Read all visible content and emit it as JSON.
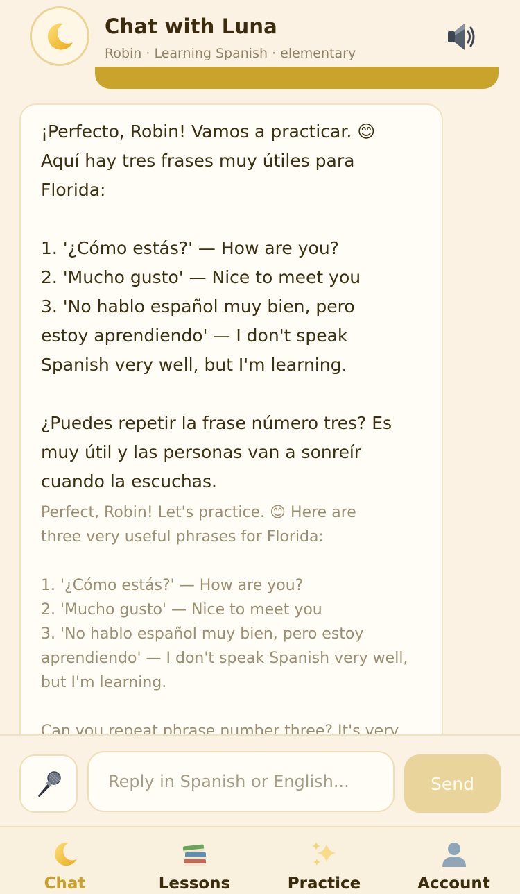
{
  "header": {
    "title": "Chat with Luna",
    "subtitle": "Robin · Learning Spanish · elementary",
    "avatar_icon": "crescent-moon-icon",
    "speaker_icon": "speaker-icon"
  },
  "message": {
    "spanish": "¡Perfecto, Robin! Vamos a practicar. 😊\nAquí hay tres frases muy útiles para\nFlorida:\n\n1. '¿Cómo estás?' — How are you?\n2. 'Mucho gusto' — Nice to meet you\n3. 'No hablo español muy bien, pero\nestoy aprendiendo' — I don't speak\nSpanish very well, but I'm learning.\n\n¿Puedes repetir la frase número tres? Es\nmuy útil y las personas van a sonreír\ncuando la escuchas.",
    "english": "Perfect, Robin! Let's practice. 😊 Here are\nthree very useful phrases for Florida:\n\n1. '¿Cómo estás?' — How are you?\n2. 'Mucho gusto' — Nice to meet you\n3. 'No hablo español muy bien, pero estoy\naprendiendo' — I don't speak Spanish very well,\nbut I'm learning.\n\nCan you repeat phrase number three? It's very"
  },
  "composer": {
    "mic_icon": "microphone-icon",
    "placeholder": "Reply in Spanish or English...",
    "send_label": "Send"
  },
  "nav": {
    "items": [
      {
        "label": "Chat",
        "icon": "crescent-moon-icon",
        "active": true
      },
      {
        "label": "Lessons",
        "icon": "books-icon",
        "active": false
      },
      {
        "label": "Practice",
        "icon": "sparkles-icon",
        "active": false
      },
      {
        "label": "Account",
        "icon": "person-icon",
        "active": false
      }
    ]
  },
  "colors": {
    "background": "#fcf2e3",
    "accent": "#c9a12a",
    "send_button": "#e9d49b",
    "bubble": "#fffdf6"
  }
}
